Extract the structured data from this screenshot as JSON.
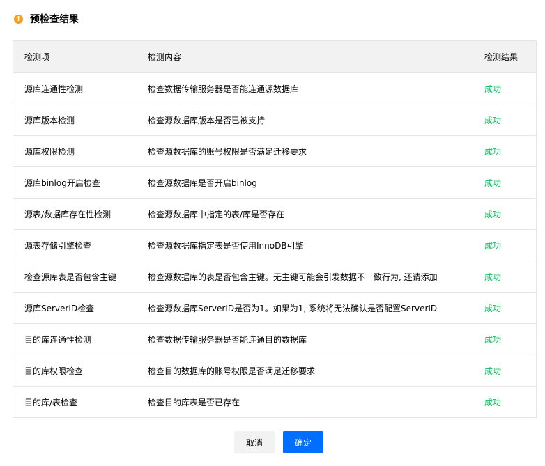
{
  "header": {
    "icon": "warning-icon",
    "title": "预检查结果"
  },
  "table": {
    "columns": [
      "检测项",
      "检测内容",
      "检测结果"
    ],
    "rows": [
      {
        "item": "源库连通性检测",
        "content": "检查数据传输服务器是否能连通源数据库",
        "result": "成功"
      },
      {
        "item": "源库版本检测",
        "content": "检查源数据库版本是否已被支持",
        "result": "成功"
      },
      {
        "item": "源库权限检测",
        "content": "检查源数据库的账号权限是否满足迁移要求",
        "result": "成功"
      },
      {
        "item": "源库binlog开启检查",
        "content": "检查源数据库是否开启binlog",
        "result": "成功"
      },
      {
        "item": "源表/数据库存在性检测",
        "content": "检查源数据库中指定的表/库是否存在",
        "result": "成功"
      },
      {
        "item": "源表存储引擎检查",
        "content": "检查源数据库指定表是否使用InnoDB引擎",
        "result": "成功"
      },
      {
        "item": "检查源库表是否包含主键",
        "content": "检查源数据库的表是否包含主键。无主键可能会引发数据不一致行为, 还请添加",
        "result": "成功"
      },
      {
        "item": "源库ServerID检查",
        "content": "检查源数据库ServerID是否为1。如果为1, 系统将无法确认是否配置ServerID",
        "result": "成功"
      },
      {
        "item": "目的库连通性检测",
        "content": "检查数据传输服务器是否能连通目的数据库",
        "result": "成功"
      },
      {
        "item": "目的库权限检查",
        "content": "检查目的数据库的账号权限是否满足迁移要求",
        "result": "成功"
      },
      {
        "item": "目的库/表检查",
        "content": "检查目的库表是否已存在",
        "result": "成功"
      }
    ]
  },
  "footer": {
    "cancel_label": "取消",
    "confirm_label": "确定"
  },
  "colors": {
    "success": "#0abf5b",
    "primary": "#006eff",
    "warning": "#ff9c19"
  }
}
